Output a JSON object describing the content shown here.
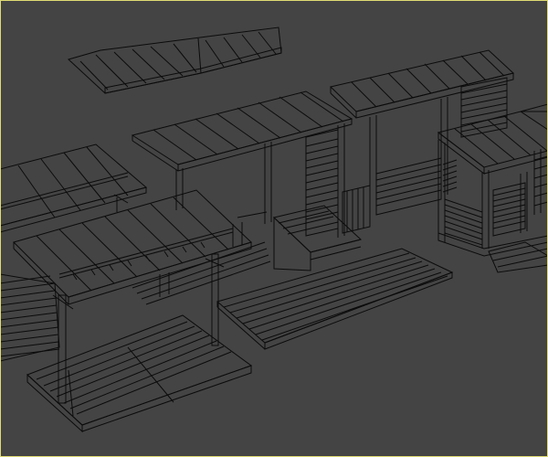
{
  "viewport": {
    "background_color": "#444444",
    "wire_color": "#0b0b0b",
    "border_color": "#e0dc74",
    "render_mode": "wireframe",
    "objects": [
      {
        "name": "roof-panel-floating"
      },
      {
        "name": "pergola-left"
      },
      {
        "name": "pergola-front-left"
      },
      {
        "name": "pergola-center"
      },
      {
        "name": "pergola-back-right"
      },
      {
        "name": "pergola-right-enclosed"
      },
      {
        "name": "deck-platform-center"
      },
      {
        "name": "deck-platform-left-floor"
      },
      {
        "name": "pergola-edge-right"
      }
    ]
  }
}
